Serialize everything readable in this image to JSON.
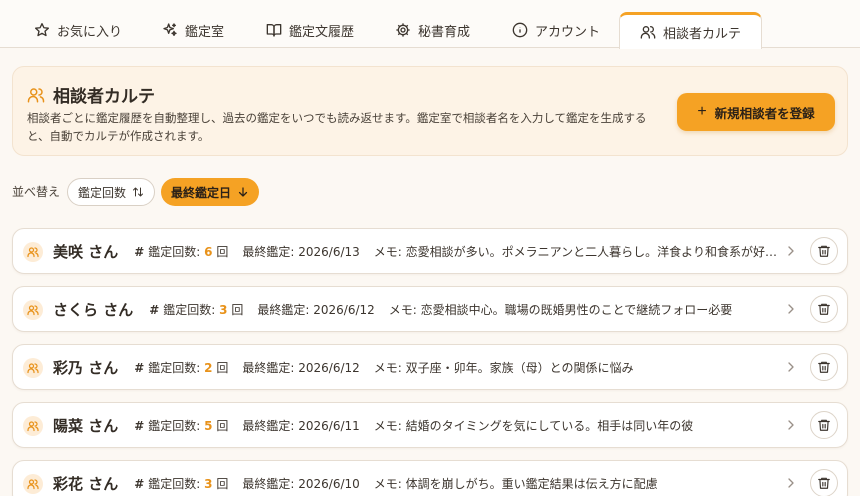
{
  "tabs": [
    {
      "label": "お気に入り",
      "icon": "star-icon"
    },
    {
      "label": "鑑定室",
      "icon": "sparkles-icon"
    },
    {
      "label": "鑑定文履歴",
      "icon": "book-icon"
    },
    {
      "label": "秘書育成",
      "icon": "gear-icon"
    },
    {
      "label": "アカウント",
      "icon": "info-icon"
    },
    {
      "label": "相談者カルテ",
      "icon": "users-icon",
      "active": true
    }
  ],
  "hero": {
    "title": "相談者カルテ",
    "description": "相談者ごとに鑑定履歴を自動整理し、過去の鑑定をいつでも読み返せます。鑑定室で相談者名を入力して鑑定を生成すると、自動でカルテが作成されます。",
    "button_label": "新規相談者を登録"
  },
  "sort": {
    "label": "並べ替え",
    "options": [
      {
        "label": "鑑定回数",
        "active": false
      },
      {
        "label": "最終鑑定日",
        "active": true
      }
    ]
  },
  "list": {
    "count_label": "鑑定回数:",
    "count_unit": "回",
    "date_label": "最終鑑定:",
    "memo_label": "メモ:",
    "clients": [
      {
        "name": "美咲 さん",
        "count": "6",
        "last": "2026/6/13",
        "memo": "恋愛相談が多い。ポメラニアンと二人暮らし。洋食より和食系が好み。"
      },
      {
        "name": "さくら さん",
        "count": "3",
        "last": "2026/6/12",
        "memo": "恋愛相談中心。職場の既婚男性のことで継続フォロー必要"
      },
      {
        "name": "彩乃 さん",
        "count": "2",
        "last": "2026/6/12",
        "memo": "双子座・卯年。家族（母）との関係に悩み"
      },
      {
        "name": "陽菜 さん",
        "count": "5",
        "last": "2026/6/11",
        "memo": "結婚のタイミングを気にしている。相手は同い年の彼"
      },
      {
        "name": "彩花 さん",
        "count": "3",
        "last": "2026/6/10",
        "memo": "体調を崩しがち。重い鑑定結果は伝え方に配慮"
      }
    ]
  },
  "colors": {
    "accent": "#f5a224",
    "count": "#e8921a",
    "hero_bg": "#fdf3e6",
    "page_bg": "#fcf8f3"
  }
}
